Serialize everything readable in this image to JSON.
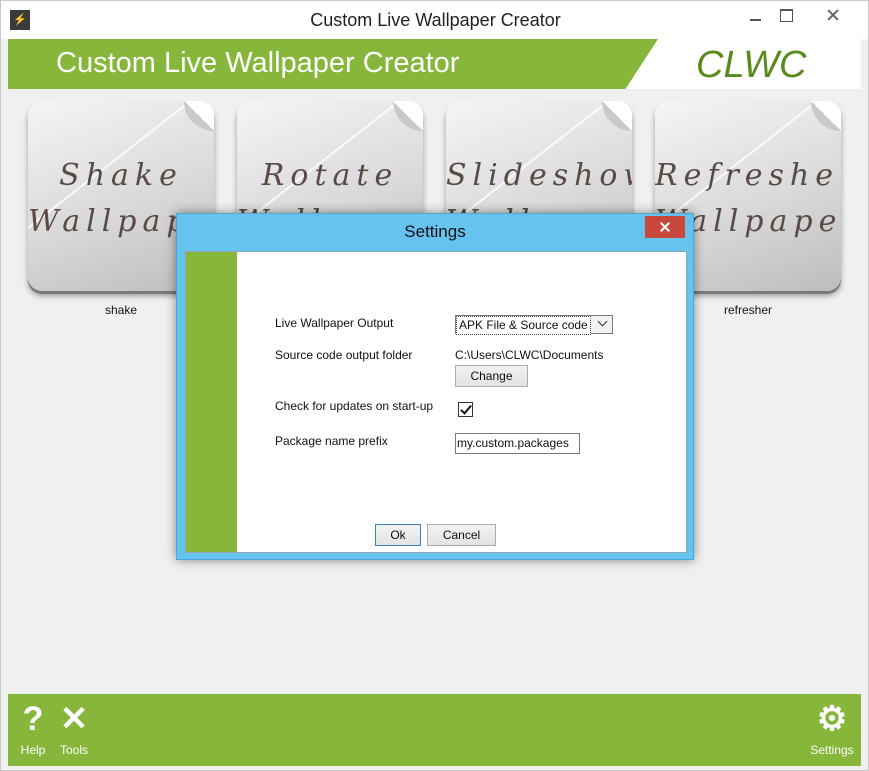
{
  "window": {
    "title": "Custom Live Wallpaper Creator",
    "icon": "app-icon"
  },
  "header": {
    "title": "Custom Live Wallpaper Creator",
    "logo": "CLWC",
    "accent_color": "#86b73a"
  },
  "tiles": [
    {
      "art_line1": "Shake",
      "art_line2": "Wallpaper",
      "label": "shake"
    },
    {
      "art_line1": "Rotate",
      "art_line2": "Wallpaper",
      "label": ""
    },
    {
      "art_line1": "Slideshow",
      "art_line2": "Wallpaper",
      "label": ""
    },
    {
      "art_line1": "Refresher",
      "art_line2": "Wallpaper",
      "label": "refresher"
    }
  ],
  "dialog": {
    "title": "Settings",
    "output_label": "Live Wallpaper Output",
    "output_value": "APK File & Source code",
    "folder_label": "Source code output folder",
    "folder_path": "C:\\Users\\CLWC\\Documents",
    "change_label": "Change",
    "updates_label": "Check for updates on start-up",
    "updates_checked": true,
    "prefix_label": "Package name prefix",
    "prefix_value": "my.custom.packages",
    "ok_label": "Ok",
    "cancel_label": "Cancel"
  },
  "footer": {
    "help_label": "Help",
    "tools_label": "Tools",
    "settings_label": "Settings"
  }
}
